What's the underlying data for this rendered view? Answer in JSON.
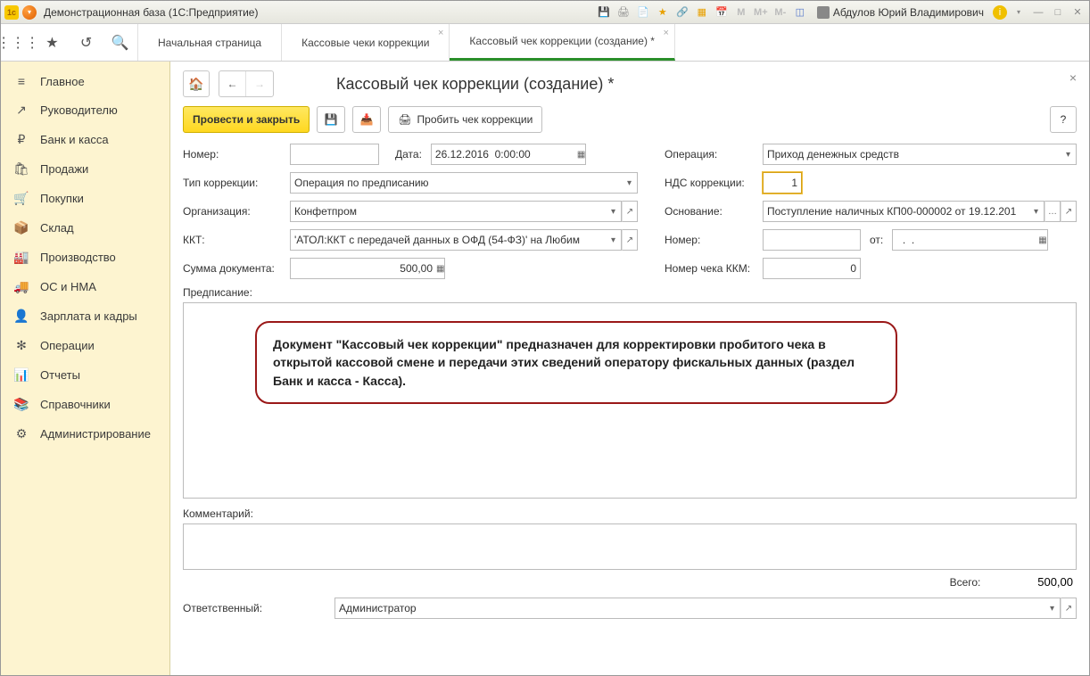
{
  "titlebar": {
    "title": "Демонстрационная база  (1С:Предприятие)",
    "user": "Абдулов Юрий Владимирович",
    "icons": [
      "save",
      "print",
      "page",
      "star",
      "calc",
      "grid",
      "calendar"
    ],
    "m_icons": [
      "M",
      "M+",
      "M-"
    ]
  },
  "tabs": [
    {
      "label": "Начальная страница",
      "closable": false,
      "active": false
    },
    {
      "label": "Кассовые чеки коррекции",
      "closable": true,
      "active": false
    },
    {
      "label": "Кассовый чек коррекции (создание) *",
      "closable": true,
      "active": true
    }
  ],
  "sidebar": [
    {
      "icon": "≡",
      "label": "Главное"
    },
    {
      "icon": "↗",
      "label": "Руководителю"
    },
    {
      "icon": "₽",
      "label": "Банк и касса"
    },
    {
      "icon": "🛍",
      "label": "Продажи"
    },
    {
      "icon": "🛒",
      "label": "Покупки"
    },
    {
      "icon": "📦",
      "label": "Склад"
    },
    {
      "icon": "🏭",
      "label": "Производство"
    },
    {
      "icon": "🚚",
      "label": "ОС и НМА"
    },
    {
      "icon": "👤",
      "label": "Зарплата и кадры"
    },
    {
      "icon": "✻",
      "label": "Операции"
    },
    {
      "icon": "📊",
      "label": "Отчеты"
    },
    {
      "icon": "📚",
      "label": "Справочники"
    },
    {
      "icon": "⚙",
      "label": "Администрирование"
    }
  ],
  "page": {
    "title": "Кассовый чек коррекции (создание) *",
    "buttons": {
      "post_close": "Провести и закрыть",
      "receipt": "Пробить чек коррекции",
      "help": "?"
    },
    "fields": {
      "number_label": "Номер:",
      "number_value": "",
      "date_label": "Дата:",
      "date_value": "26.12.2016  0:00:00",
      "operation_label": "Операция:",
      "operation_value": "Приход денежных средств",
      "corr_type_label": "Тип коррекции:",
      "corr_type_value": "Операция по предписанию",
      "vat_label": "НДС коррекции:",
      "vat_value": "1",
      "org_label": "Организация:",
      "org_value": "Конфетпром",
      "basis_label": "Основание:",
      "basis_value": "Поступление наличных КП00-000002 от 19.12.201",
      "kkt_label": "ККТ:",
      "kkt_value": "'АТОЛ:ККТ с передачей данных в ОФД (54-ФЗ)' на Любим",
      "number2_label": "Номер:",
      "number2_value": "",
      "from_label": "от:",
      "from_value": "  .  .",
      "sum_label": "Сумма документа:",
      "sum_value": "500,00",
      "kkm_label": "Номер чека ККМ:",
      "kkm_value": "0",
      "prescription_label": "Предписание:",
      "comment_label": "Комментарий:",
      "total_label": "Всего:",
      "total_value": "500,00",
      "responsible_label": "Ответственный:",
      "responsible_value": "Администратор"
    },
    "callout": "Документ \"Кассовый чек коррекции\" предназначен для корректировки пробитого чека в открытой кассовой смене и передачи этих сведений оператору фискальных данных  (раздел Банк и касса - Касса)."
  }
}
